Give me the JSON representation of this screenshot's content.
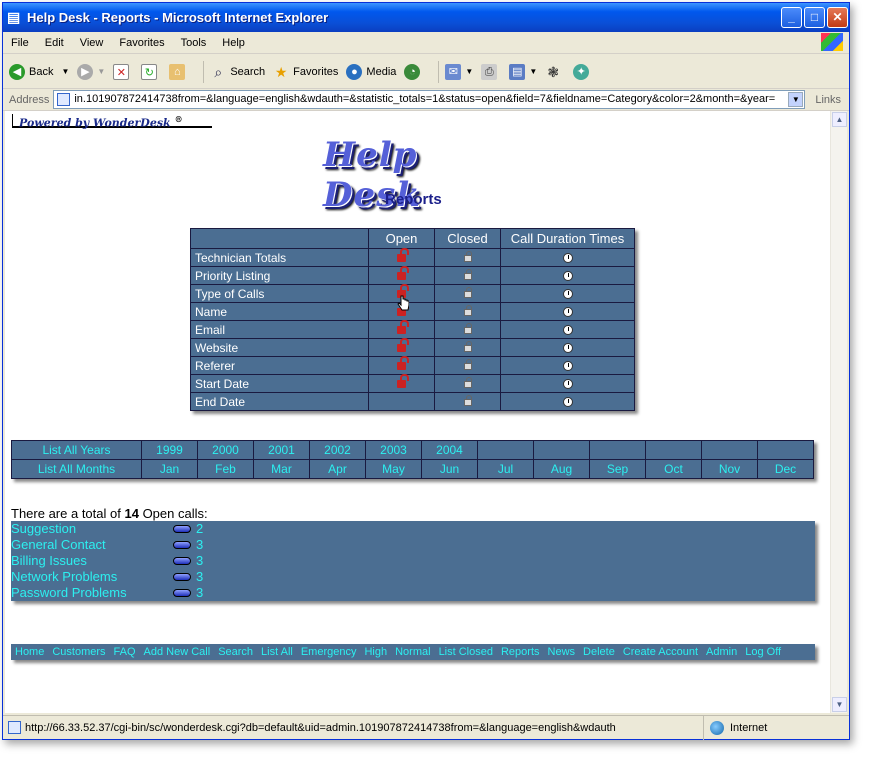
{
  "window": {
    "title": "Help Desk - Reports - Microsoft Internet Explorer"
  },
  "menu": [
    "File",
    "Edit",
    "View",
    "Favorites",
    "Tools",
    "Help"
  ],
  "toolbar": {
    "back": "Back",
    "search": "Search",
    "favorites": "Favorites",
    "media": "Media"
  },
  "address": {
    "label": "Address",
    "url": "in.101907872414738from=&language=english&wdauth=&statistic_totals=1&status=open&field=7&fieldname=Category&color=2&month=&year=",
    "links": "Links"
  },
  "page": {
    "powered": "Powered by WonderDesk",
    "powered_mark": "®",
    "logo": "Help Desk",
    "title": "Reports",
    "report_headers": [
      "",
      "Open",
      "Closed",
      "Call Duration Times"
    ],
    "report_rows": [
      {
        "label": "Technician Totals",
        "open": true
      },
      {
        "label": "Priority Listing",
        "open": true
      },
      {
        "label": "Type of Calls",
        "open": true
      },
      {
        "label": "Name",
        "open": true
      },
      {
        "label": "Email",
        "open": true
      },
      {
        "label": "Website",
        "open": true
      },
      {
        "label": "Referer",
        "open": true
      },
      {
        "label": "Start Date",
        "open": true
      },
      {
        "label": "End Date",
        "open": false
      }
    ],
    "years_label": "List All Years",
    "years": [
      "1999",
      "2000",
      "2001",
      "2002",
      "2003",
      "2004",
      "",
      "",
      "",
      "",
      "",
      ""
    ],
    "months_label": "List All Months",
    "months": [
      "Jan",
      "Feb",
      "Mar",
      "Apr",
      "May",
      "Jun",
      "Jul",
      "Aug",
      "Sep",
      "Oct",
      "Nov",
      "Dec"
    ],
    "total_prefix": "There are a total of",
    "total_count": "14",
    "total_suffix": "Open calls:",
    "categories": [
      {
        "name": "Suggestion",
        "count": "2"
      },
      {
        "name": "General Contact",
        "count": "3"
      },
      {
        "name": "Billing Issues",
        "count": "3"
      },
      {
        "name": "Network Problems",
        "count": "3"
      },
      {
        "name": "Password Problems",
        "count": "3"
      }
    ],
    "nav": [
      "Home",
      "Customers",
      "FAQ",
      "Add New Call",
      "Search",
      "List All",
      "Emergency",
      "High",
      "Normal",
      "List Closed",
      "Reports",
      "News",
      "Delete",
      "Create Account",
      "Admin",
      "Log Off"
    ]
  },
  "status": {
    "text": "http://66.33.52.37/cgi-bin/sc/wonderdesk.cgi?db=default&uid=admin.101907872414738from=&language=english&wdauth",
    "zone": "Internet"
  },
  "colors": {
    "table_bg": "#4b6e92",
    "link": "#2cf0f0",
    "title": "#1b1f8a"
  }
}
